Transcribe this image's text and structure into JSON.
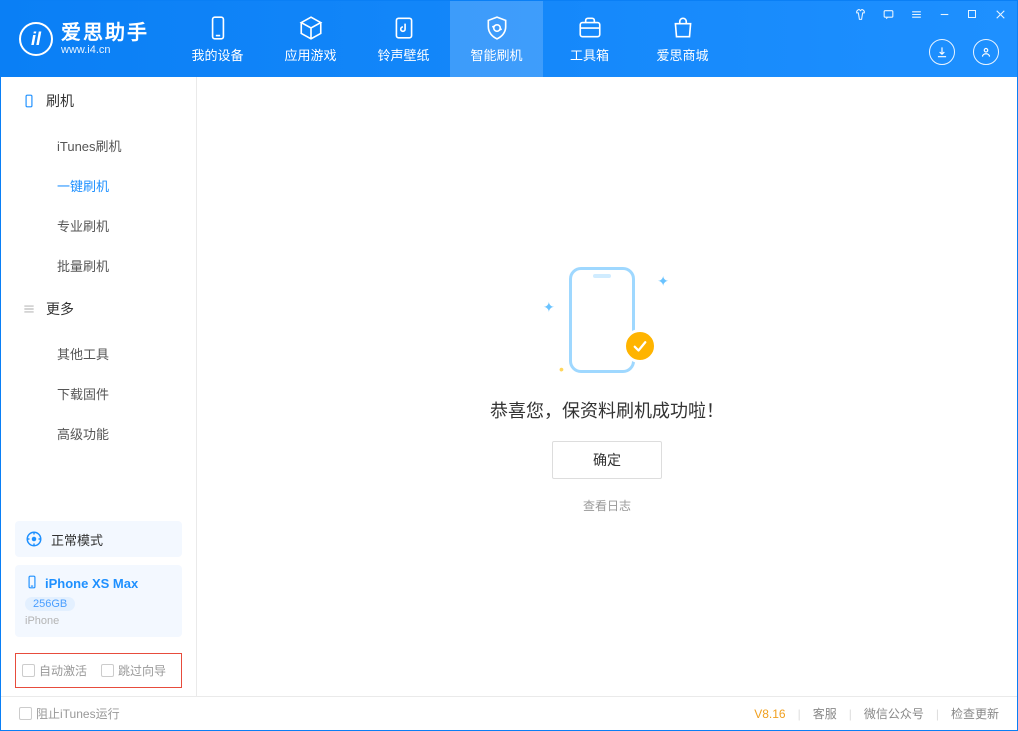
{
  "app": {
    "title": "爱思助手",
    "subtitle": "www.i4.cn"
  },
  "tabs": {
    "device": "我的设备",
    "apps": "应用游戏",
    "ringtone": "铃声壁纸",
    "flash": "智能刷机",
    "toolbox": "工具箱",
    "store": "爱思商城"
  },
  "sidebar": {
    "section_flash": "刷机",
    "items_flash": {
      "itunes": "iTunes刷机",
      "oneclick": "一键刷机",
      "pro": "专业刷机",
      "batch": "批量刷机"
    },
    "section_more": "更多",
    "items_more": {
      "other": "其他工具",
      "download": "下载固件",
      "advanced": "高级功能"
    }
  },
  "mode": {
    "label": "正常模式"
  },
  "device": {
    "name": "iPhone XS Max",
    "capacity": "256GB",
    "type": "iPhone"
  },
  "options": {
    "auto_activate": "自动激活",
    "skip_guide": "跳过向导"
  },
  "result": {
    "message": "恭喜您，保资料刷机成功啦！",
    "ok": "确定",
    "log": "查看日志"
  },
  "footer": {
    "block_itunes": "阻止iTunes运行",
    "version": "V8.16",
    "support": "客服",
    "wechat": "微信公众号",
    "update": "检查更新"
  }
}
